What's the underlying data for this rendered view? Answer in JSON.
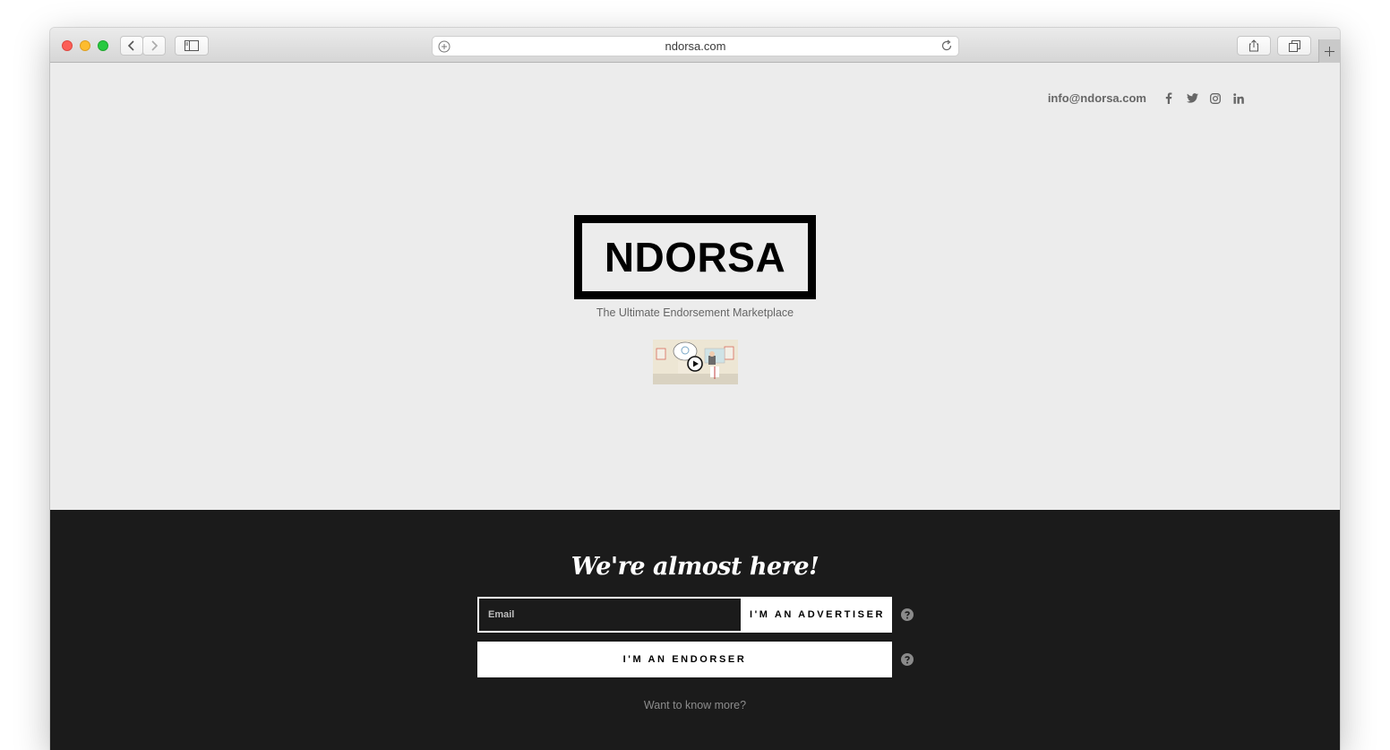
{
  "browser": {
    "url": "ndorsa.com"
  },
  "header": {
    "email": "info@ndorsa.com",
    "social_icons": [
      "facebook-icon",
      "twitter-icon",
      "instagram-icon",
      "linkedin-icon"
    ]
  },
  "hero": {
    "logo": "NDORSA",
    "tagline": "The Ultimate Endorsement Marketplace"
  },
  "signup": {
    "heading": "We're almost here!",
    "email_placeholder": "Email",
    "advertiser_label": "I'M AN ADVERTISER",
    "endorser_label": "I'M AN ENDORSER",
    "more_link": "Want to know more?"
  },
  "colors": {
    "hero_bg": "#ececec",
    "footer_bg": "#1b1b1b",
    "text_dark": "#000000",
    "social_icon": "#666666"
  }
}
